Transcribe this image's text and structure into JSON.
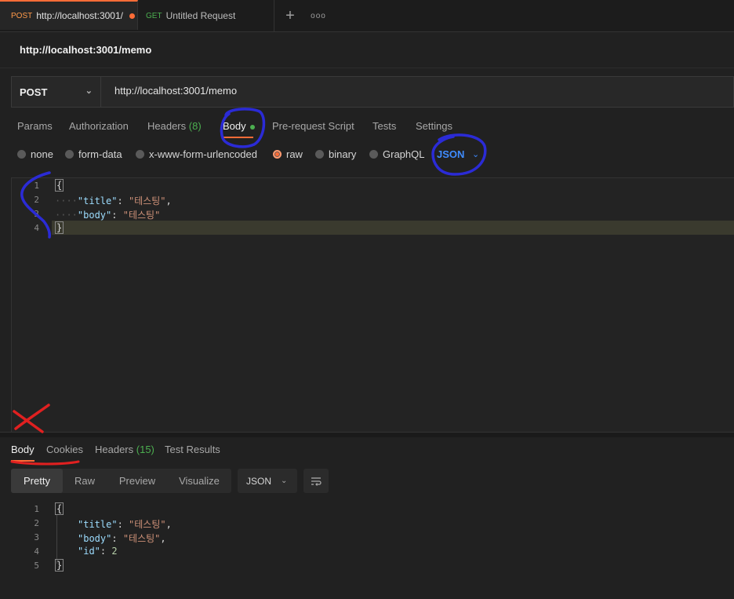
{
  "tabs": [
    {
      "method": "POST",
      "title": "http://localhost:3001/"
    },
    {
      "method": "GET",
      "title": "Untitled Request"
    }
  ],
  "tab_actions": {
    "add": "+",
    "more": "ooo"
  },
  "request": {
    "name": "http://localhost:3001/memo",
    "method": "POST",
    "url": "http://localhost:3001/memo"
  },
  "request_tabs": {
    "params": "Params",
    "authorization": "Authorization",
    "headers": "Headers",
    "headers_count": "(8)",
    "body": "Body",
    "pre_request": "Pre-request Script",
    "tests": "Tests",
    "settings": "Settings"
  },
  "body_types": {
    "none": "none",
    "form_data": "form-data",
    "urlencoded": "x-www-form-urlencoded",
    "raw": "raw",
    "binary": "binary",
    "graphql": "GraphQL",
    "selected": "raw",
    "format": "JSON"
  },
  "request_body": {
    "line_numbers": [
      "1",
      "2",
      "3",
      "4"
    ],
    "open_brace": "{",
    "close_brace": "}",
    "title_key": "\"title\"",
    "title_value": "\"테스팅\"",
    "body_key": "\"body\"",
    "body_value": "\"테스팅\""
  },
  "response_tabs": {
    "body": "Body",
    "cookies": "Cookies",
    "headers": "Headers",
    "headers_count": "(15)",
    "test_results": "Test Results"
  },
  "response_view": {
    "pretty": "Pretty",
    "raw": "Raw",
    "preview": "Preview",
    "visualize": "Visualize",
    "format": "JSON",
    "active": "Pretty"
  },
  "response_body": {
    "line_numbers": [
      "1",
      "2",
      "3",
      "4",
      "5"
    ],
    "open_brace": "{",
    "close_brace": "}",
    "title_key": "\"title\"",
    "title_value": "\"테스팅\"",
    "body_key": "\"body\"",
    "body_value": "\"테스팅\"",
    "id_key": "\"id\"",
    "id_value": "2"
  },
  "colors": {
    "accent": "#ff6c37",
    "success": "#4caf50",
    "link": "#3f8cff",
    "annotation_blue": "#2b2bd6",
    "annotation_red": "#e02020"
  }
}
